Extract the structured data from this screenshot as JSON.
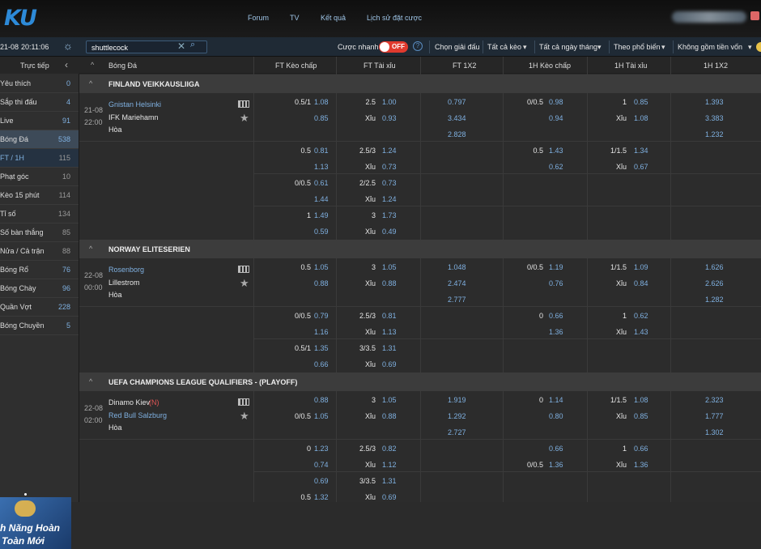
{
  "brand": {
    "logo": "KU"
  },
  "nav": [
    "Forum",
    "TV",
    "Kết quả",
    "Lịch sử đặt cược"
  ],
  "clock": {
    "date": "21-08",
    "time": "20:11:06"
  },
  "search": {
    "value": "shuttlecock"
  },
  "toolbar": {
    "quick_bet": "Cược nhanh",
    "toggle": "OFF",
    "choose_league": "Chọn giải đấu",
    "all_odds": "Tất cả kèo",
    "all_dates": "Tất cả ngày tháng",
    "sort": "Theo phổ biến",
    "capital": "Không gồm tiền vốn"
  },
  "sidebar": {
    "header": "Trực tiếp",
    "items": [
      {
        "label": "Yêu thích",
        "count": "0"
      },
      {
        "label": "Sắp thi đấu",
        "count": "4"
      },
      {
        "label": "Live",
        "count": "91"
      },
      {
        "label": "Bóng Đá",
        "count": "538"
      },
      {
        "label": "FT / 1H",
        "count": "115"
      },
      {
        "label": "Phạt góc",
        "count": "10"
      },
      {
        "label": "Kèo 15 phút",
        "count": "114"
      },
      {
        "label": "Tỉ số",
        "count": "134"
      },
      {
        "label": "Số bàn thắng",
        "count": "85"
      },
      {
        "label": "Nửa / Cả trận",
        "count": "88"
      },
      {
        "label": "Bóng Rổ",
        "count": "76"
      },
      {
        "label": "Bóng Chày",
        "count": "96"
      },
      {
        "label": "Quần Vợt",
        "count": "228"
      },
      {
        "label": "Bóng Chuyền",
        "count": "5"
      }
    ],
    "banner_line1": "h Năng Hoàn",
    "banner_line2": "Toàn Mới"
  },
  "columns": {
    "sport": "Bóng Đá",
    "c1": "FT Kèo chấp",
    "c2": "FT Tài xỉu",
    "c3": "FT 1X2",
    "c4": "1H Kèo chấp",
    "c5": "1H Tài xỉu",
    "c6": "1H 1X2"
  },
  "leagues": [
    {
      "name": "FINLAND VEIKKAUSLIIGA",
      "date": "21-08",
      "time": "22:00",
      "home": "Gnistan Helsinki",
      "away": "IFK Mariehamn",
      "draw": "Hòa",
      "home_mark": "",
      "rows": [
        [
          "0.5/1",
          "1.08",
          "2.5",
          "1.00",
          "0.797",
          "0/0.5",
          "0.98",
          "1",
          "0.85",
          "1.393"
        ],
        [
          "",
          "0.85",
          "Xỉu",
          "0.93",
          "3.434",
          "",
          "0.94",
          "Xỉu",
          "1.08",
          "3.383"
        ],
        [
          "",
          "",
          "",
          "",
          "2.828",
          "",
          "",
          "",
          "",
          "1.232"
        ],
        [
          "0.5",
          "0.81",
          "2.5/3",
          "1.24",
          "",
          "0.5",
          "1.43",
          "1/1.5",
          "1.34",
          ""
        ],
        [
          "",
          "1.13",
          "Xỉu",
          "0.73",
          "",
          "",
          "0.62",
          "Xỉu",
          "0.67",
          ""
        ],
        [
          "0/0.5",
          "0.61",
          "2/2.5",
          "0.73",
          "",
          "",
          "",
          "",
          "",
          ""
        ],
        [
          "",
          "1.44",
          "Xỉu",
          "1.24",
          "",
          "",
          "",
          "",
          "",
          ""
        ],
        [
          "1",
          "1.49",
          "3",
          "1.73",
          "",
          "",
          "",
          "",
          "",
          ""
        ],
        [
          "",
          "0.59",
          "Xỉu",
          "0.49",
          "",
          "",
          "",
          "",
          "",
          ""
        ]
      ]
    },
    {
      "name": "NORWAY ELITESERIEN",
      "date": "22-08",
      "time": "00:00",
      "home": "Rosenborg",
      "away": "Lillestrom",
      "draw": "Hòa",
      "home_mark": "",
      "rows": [
        [
          "0.5",
          "1.05",
          "3",
          "1.05",
          "1.048",
          "0/0.5",
          "1.19",
          "1/1.5",
          "1.09",
          "1.626"
        ],
        [
          "",
          "0.88",
          "Xỉu",
          "0.88",
          "2.474",
          "",
          "0.76",
          "Xỉu",
          "0.84",
          "2.626"
        ],
        [
          "",
          "",
          "",
          "",
          "2.777",
          "",
          "",
          "",
          "",
          "1.282"
        ],
        [
          "0/0.5",
          "0.79",
          "2.5/3",
          "0.81",
          "",
          "0",
          "0.66",
          "1",
          "0.62",
          ""
        ],
        [
          "",
          "1.16",
          "Xỉu",
          "1.13",
          "",
          "",
          "1.36",
          "Xỉu",
          "1.43",
          ""
        ],
        [
          "0.5/1",
          "1.35",
          "3/3.5",
          "1.31",
          "",
          "",
          "",
          "",
          "",
          ""
        ],
        [
          "",
          "0.66",
          "Xỉu",
          "0.69",
          "",
          "",
          "",
          "",
          "",
          ""
        ]
      ]
    },
    {
      "name": "UEFA CHAMPIONS LEAGUE QUALIFIERS - (PLAYOFF)",
      "date": "22-08",
      "time": "02:00",
      "home": "Dinamo Kiev",
      "away": "Red Bull Salzburg",
      "draw": "Hòa",
      "home_mark": "(N)",
      "rows": [
        [
          "",
          "0.88",
          "3",
          "1.05",
          "1.919",
          "0",
          "1.14",
          "1/1.5",
          "1.08",
          "2.323"
        ],
        [
          "0/0.5",
          "1.05",
          "Xỉu",
          "0.88",
          "1.292",
          "",
          "0.80",
          "Xỉu",
          "0.85",
          "1.777"
        ],
        [
          "",
          "",
          "",
          "",
          "2.727",
          "",
          "",
          "",
          "",
          "1.302"
        ],
        [
          "0",
          "1.23",
          "2.5/3",
          "0.82",
          "",
          "",
          "0.66",
          "1",
          "0.66",
          ""
        ],
        [
          "",
          "0.74",
          "Xỉu",
          "1.12",
          "",
          "0/0.5",
          "1.36",
          "Xỉu",
          "1.36",
          ""
        ],
        [
          "",
          "0.69",
          "3/3.5",
          "1.31",
          "",
          "",
          "",
          "",
          "",
          ""
        ],
        [
          "0.5",
          "1.32",
          "Xỉu",
          "0.69",
          "",
          "",
          "",
          "",
          "",
          ""
        ]
      ]
    }
  ]
}
